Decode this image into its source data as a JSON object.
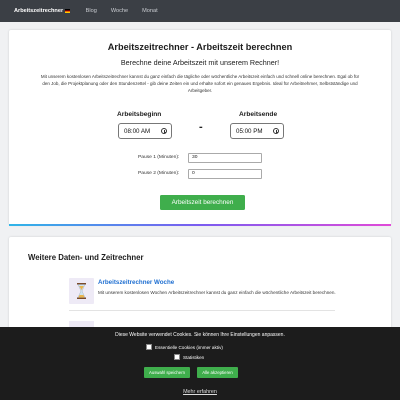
{
  "nav": {
    "brand": "Arbeitszeitrechner",
    "links": [
      "Blog",
      "Woche",
      "Monat"
    ]
  },
  "calculator": {
    "title": "Arbeitszeitrechner - Arbeitszeit berechnen",
    "subtitle": "Berechne deine Arbeitszeit mit unserem Rechner!",
    "description": "Mit unserem kostenlosen Arbeitszeitrechner kannst du ganz einfach die tägliche oder wöchentliche Arbeitszeit einfach und schnell online berechnen. Egal ob für den Job, die Projektplanung oder den Stundenzettel - gib deine Zeiten ein und erhalte sofort ein genaues Ergebnis. Ideal für Arbeitnehmer, Selbstständige und Arbeitgeber.",
    "start_label": "Arbeitsbeginn",
    "start_value": "08:00 AM",
    "end_label": "Arbeitsende",
    "end_value": "05:00 PM",
    "separator": "-",
    "pause1_label": "Pause 1 (Minuten):",
    "pause1_value": "30",
    "pause2_label": "Pause 2 (Minuten):",
    "pause2_value": "0",
    "button_label": "Arbeitszeit berechnen"
  },
  "more": {
    "title": "Weitere Daten- und Zeitrechner",
    "items": [
      {
        "title": "Arbeitszeitrechner Woche",
        "text": "Mit unserem kostenlosen Wochen Arbeitszeitrechner kannst du ganz einfach die wöchentliche Arbeitszeit berechnen."
      }
    ]
  },
  "cookie": {
    "message": "Diese Website verwendet Cookies. Sie können Ihre Einstellungen anpassen.",
    "essential": "Essentielle Cookies (immer aktiv)",
    "statistics": "Statistiken",
    "save_button": "Auswahl speichern",
    "accept_button": "Alle akzeptieren",
    "more_link": "Mehr erfahren"
  },
  "colors": {
    "nav_bg": "#3b3f45",
    "accent_green": "#3fae4c",
    "link_blue": "#1f6fd1"
  },
  "icons": [
    "clock-icon",
    "hourglass-icon",
    "flag-icon"
  ]
}
